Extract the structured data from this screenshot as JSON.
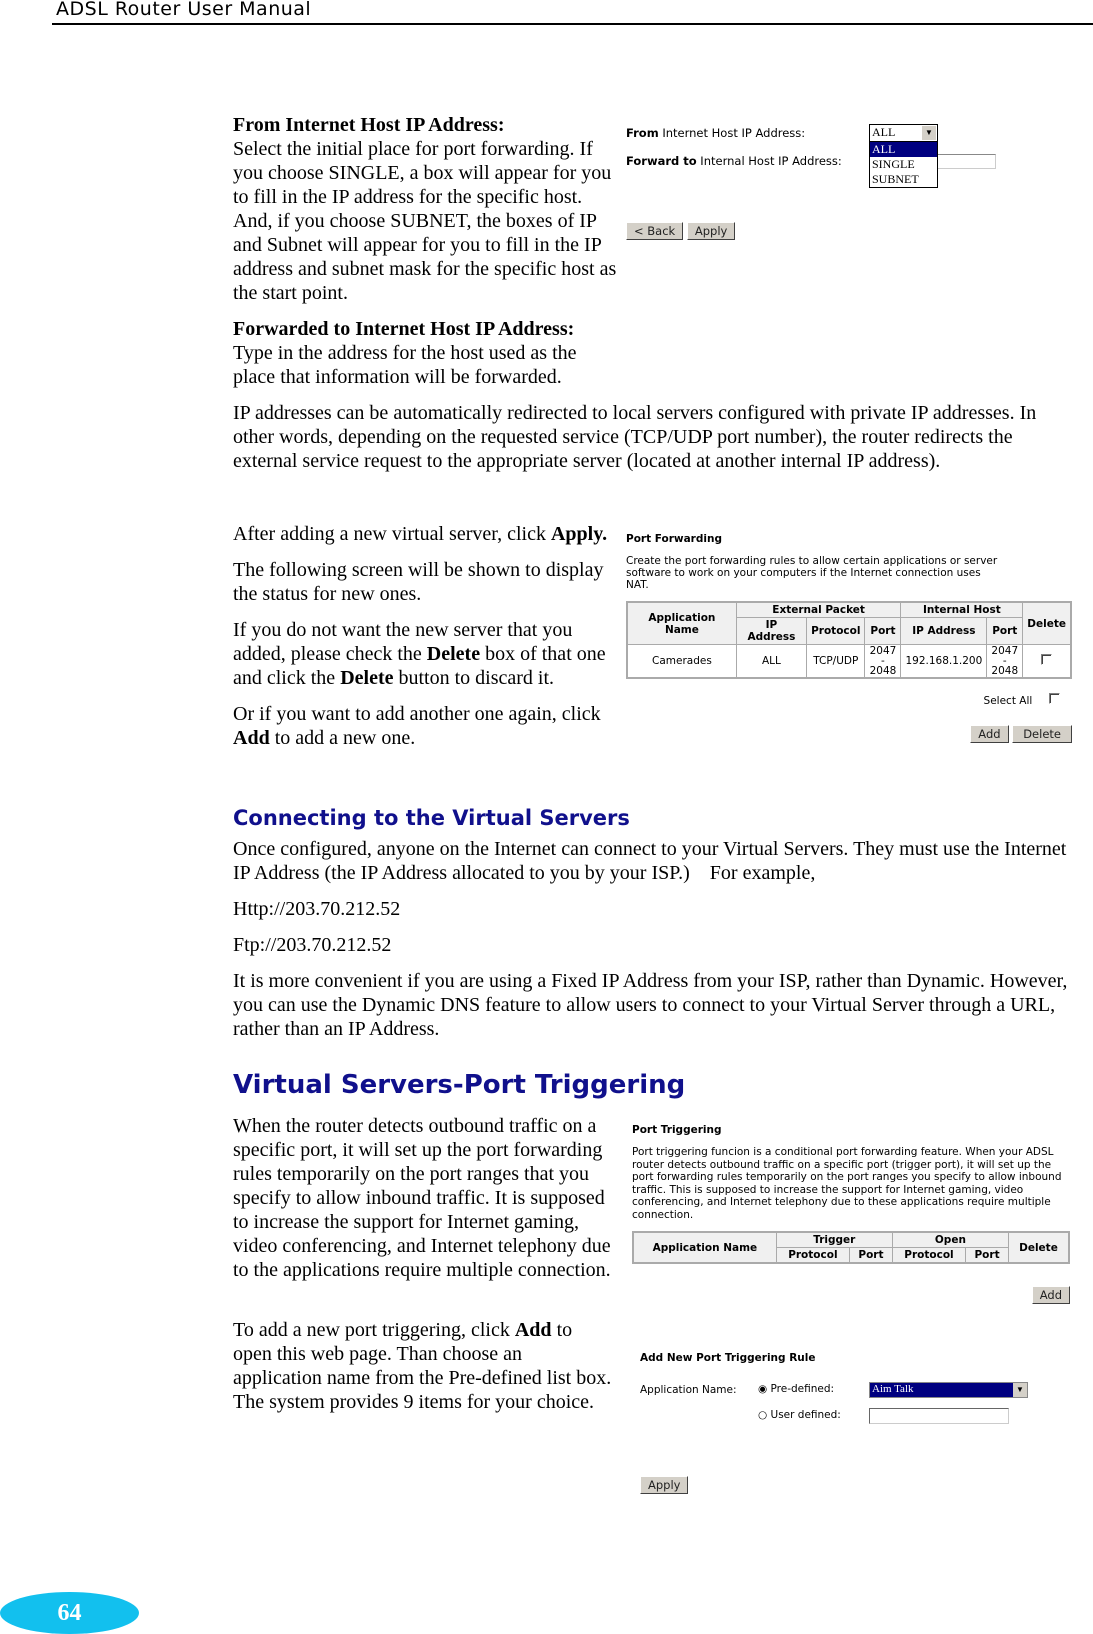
{
  "header": {
    "title": "ADSL Router User Manual"
  },
  "section1": {
    "from_heading": "From Internet Host IP Address:",
    "from_text": "Select the initial place for port forwarding. If you choose SINGLE, a box will appear for you to fill in the IP address for the specific host. And, if you choose SUBNET, the boxes of IP and Subnet will appear for you to fill in the IP address and subnet mask for the specific host as the start point.",
    "fwd_heading": "Forwarded to Internet Host IP Address:",
    "fwd_text": "Type in the address for the host used as the place that information will be forwarded.",
    "para": "IP addresses can be automatically redirected to local servers configured with private IP addresses. In other words, depending on the requested service (TCP/UDP port number), the router redirects the external service request to the appropriate server (located at another internal IP address)."
  },
  "shot1": {
    "from_bold": "From",
    "from_rest": " Internet Host IP Address:",
    "fwd_bold": "Forward to",
    "fwd_rest": " Internal Host IP Address:",
    "select_value": "ALL",
    "options": [
      "ALL",
      "SINGLE",
      "SUBNET"
    ],
    "back": "< Back",
    "apply": "Apply"
  },
  "section2": {
    "p1a": "After adding a new virtual server, click ",
    "p1b": "Apply.",
    "p2": "The following screen will be shown to display the status for new ones.",
    "p3a": "If you do not want the new server that you added, please check the ",
    "p3b": "Delete",
    "p3c": " box of that one and click the ",
    "p3d": "Delete",
    "p3e": " button to discard it.",
    "p4a": "Or if you want to add another one again, click ",
    "p4b": "Add",
    "p4c": " to add a new one."
  },
  "shot2": {
    "title": "Port Forwarding",
    "desc": "Create the port forwarding rules to allow certain applications or server software to work on your computers if the Internet connection uses NAT.",
    "headers": {
      "app": "Application Name",
      "ext": "External Packet",
      "int": "Internal Host",
      "del": "Delete",
      "ip": "IP Address",
      "proto": "Protocol",
      "port": "Port"
    },
    "row": {
      "app": "Camerades",
      "ip": "ALL",
      "proto": "TCP/UDP",
      "port": "2047 - 2048",
      "int_ip": "192.168.1.200",
      "int_port": "2047 - 2048"
    },
    "select_all": "Select All",
    "add": "Add",
    "delete": "Delete"
  },
  "section3": {
    "heading": "Connecting to the Virtual Servers",
    "p1": "Once configured, anyone on the Internet can connect to your Virtual Servers. They must use the Internet IP Address (the IP Address allocated to you by your ISP.)    For example,",
    "http": "Http://203.70.212.52",
    "ftp": "Ftp://203.70.212.52",
    "p2": "It is more convenient if you are using a Fixed IP Address from your ISP, rather than Dynamic. However, you can use the Dynamic DNS feature to allow users to connect to your Virtual Server through a URL, rather than an IP Address."
  },
  "section4": {
    "heading": "Virtual Servers-Port Triggering",
    "p1": "When the router detects outbound traffic on a specific port, it will set up the port forwarding rules temporarily on the port ranges that you specify to allow inbound traffic. It is supposed to increase the support for Internet gaming, video conferencing, and Internet telephony due to the applications require multiple connection.",
    "p2a": "To add a new port triggering, click ",
    "p2b": "Add",
    "p2c": " to open this web page. Than choose an application name from the Pre-defined list box. The system provides 9 items for your choice."
  },
  "shot3": {
    "title": "Port Triggering",
    "desc": "Port triggering funcion is a conditional port forwarding feature. When your ADSL router detects outbound traffic on a specific port (trigger port), it will set up the port forwarding rules temporarily on the port ranges you specify to allow inbound traffic. This is supposed to increase the support for Internet gaming, video conferencing, and Internet telephony due to these applications require multiple connection.",
    "headers": {
      "app": "Application Name",
      "trigger": "Trigger",
      "open": "Open",
      "del": "Delete",
      "proto": "Protocol",
      "port": "Port"
    },
    "add": "Add"
  },
  "shot4": {
    "title": "Add New Port Triggering Rule",
    "label": "Application Name:",
    "predef": "Pre-defined:",
    "userdef": "User defined:",
    "select_value": "Aim Talk",
    "apply": "Apply"
  },
  "footer": {
    "page": "64"
  }
}
